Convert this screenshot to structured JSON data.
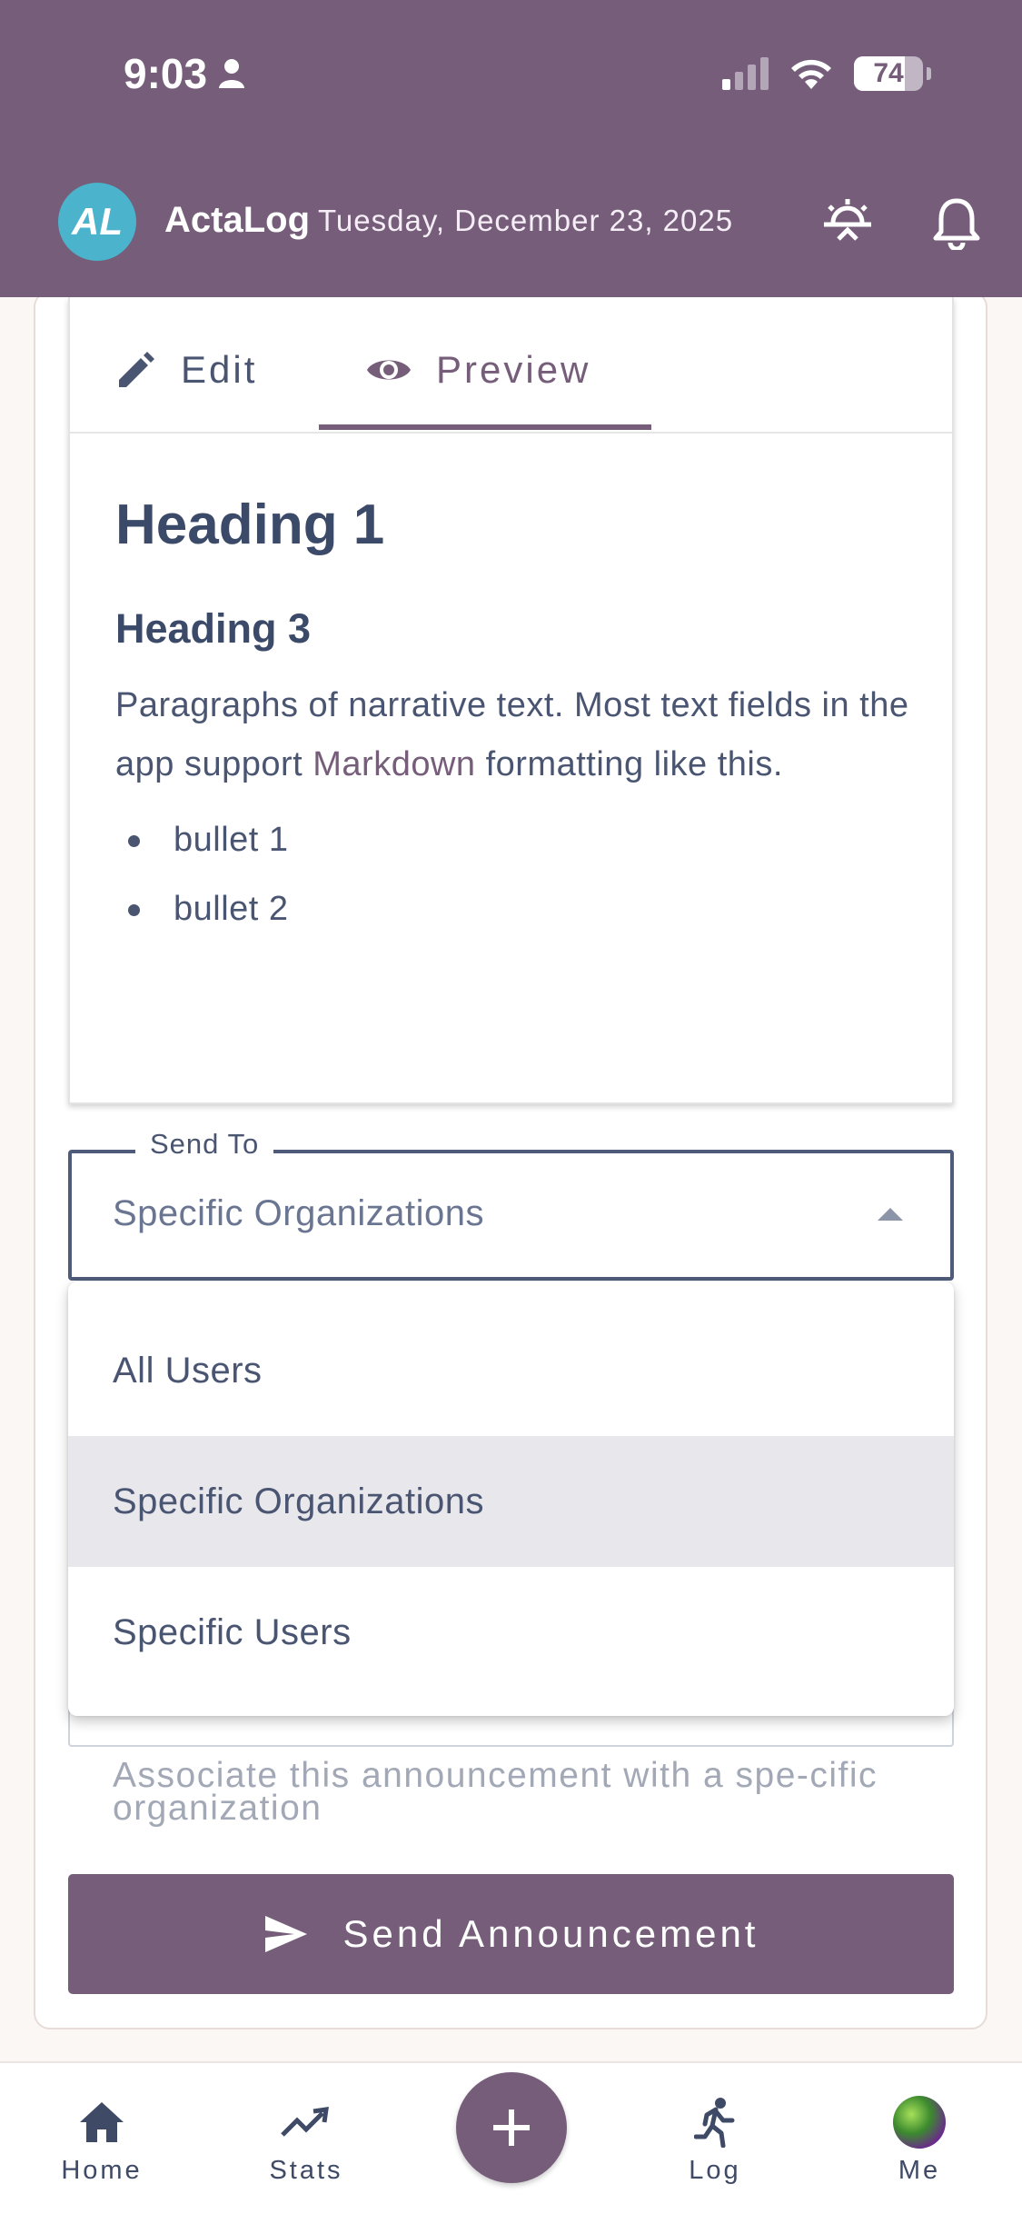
{
  "status_bar": {
    "time": "9:03",
    "battery": "74",
    "battery_level": 0.74
  },
  "header": {
    "logo_text": "AL",
    "app_name": "ActaLog",
    "date": "Tuesday, December 23, 2025"
  },
  "editor": {
    "tabs": [
      {
        "label": "Edit"
      },
      {
        "label": "Preview"
      }
    ],
    "active_tab": "Preview",
    "preview": {
      "heading1": "Heading 1",
      "heading3": "Heading 3",
      "paragraph_before": "Paragraphs of narrative text. Most text fields in the app support ",
      "paragraph_link": "Markdown",
      "paragraph_after": " formatting like this.",
      "bullets": [
        "bullet 1",
        "bullet 2"
      ]
    }
  },
  "send_to": {
    "label": "Send To",
    "value": "Specific Organizations",
    "options": [
      "All Users",
      "Specific Organizations",
      "Specific Users"
    ],
    "helper_text": "Associate this announcement with a spe-cific organization"
  },
  "send_button": {
    "label": "Send Announcement"
  },
  "bottom_nav": {
    "items": [
      {
        "label": "Home"
      },
      {
        "label": "Stats"
      },
      {
        "label": "Log"
      },
      {
        "label": "Me"
      }
    ]
  },
  "colors": {
    "primary": "#765e7a",
    "logo": "#4bb3cc",
    "text": "#4a5572"
  }
}
